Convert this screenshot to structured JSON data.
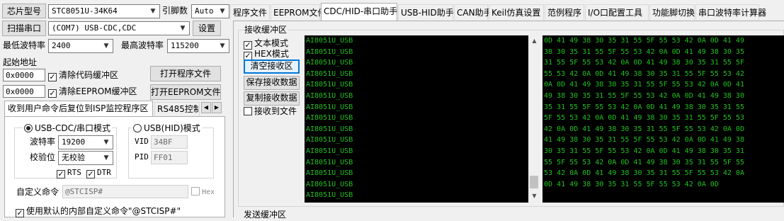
{
  "left": {
    "chip_label": "芯片型号",
    "chip_value": "STC8051U-34K64",
    "pin_label": "引脚数",
    "pin_value": "Auto",
    "scan_button": "扫描串口",
    "port_value": "(COM7) USB-CDC,CDC",
    "settings_button": "设置",
    "min_baud_label": "最低波特率",
    "min_baud_value": "2400",
    "max_baud_label": "最高波特率",
    "max_baud_value": "115200",
    "start_addr_label": "起始地址",
    "addr1": "0x0000",
    "clear_code_label": "清除代码缓冲区",
    "open_program_button": "打开程序文件",
    "addr2": "0x0000",
    "clear_eeprom_label": "清除EEPROM缓冲区",
    "open_eeprom_button": "打开EEPROM文件",
    "sub_tab_1": "收到用户命令后复位到ISP监控程序区",
    "sub_tab_2": "RS485控制",
    "usb_cdc_mode": "USB-CDC/串口模式",
    "usb_hid_mode": "USB(HID)模式",
    "baud_label": "波特率",
    "baud_value": "19200",
    "parity_label": "校验位",
    "parity_value": "无校验",
    "vid_label": "VID",
    "vid_value": "34BF",
    "pid_label": "PID",
    "pid_value": "FF01",
    "rts_label": "RTS",
    "dtr_label": "DTR",
    "custom_cmd_label": "自定义命令",
    "custom_cmd_value": "@STCISP#",
    "hex_label": "Hex",
    "use_default_label": "使用默认的内部自定义命令\"@STCISP#\""
  },
  "tabs": [
    "程序文件",
    "EEPROM文件",
    "CDC/HID-串口助手",
    "USB-HID助手",
    "CAN助手",
    "Keil仿真设置",
    "范例程序",
    "I/O口配置工具",
    "功能脚切换",
    "串口波特率计算器"
  ],
  "active_tab": 2,
  "serial": {
    "receive_buffer_label": "接收缓冲区",
    "text_mode_label": "文本模式",
    "hex_mode_label": "HEX模式",
    "clear_receive_button": "清空接收区",
    "save_receive_button": "保存接收数据",
    "copy_receive_button": "复制接收数据",
    "receive_to_file_label": "接收到文件",
    "send_buffer_label": "发送缓冲区",
    "text_lines": [
      "AI8051U_USB",
      "AI8051U_USB",
      "AI8051U_USB",
      "AI8051U_USB",
      "AI8051U_USB",
      "AI8051U_USB",
      "AI8051U_USB",
      "AI8051U_USB",
      "AI8051U_USB",
      "AI8051U_USB",
      "AI8051U_USB",
      "AI8051U_USB",
      "AI8051U_USB",
      "AI8051U_USB",
      "AI8051U_USB"
    ],
    "hex_lines": [
      "0D 41 49 38 30 35 31 55 5F 55 53 42 0A 0D 41 49",
      "38 30 35 31 55 5F 55 53 42 0A 0D 41 49 38 30 35",
      "31 55 5F 55 53 42 0A 0D 41 49 38 30 35 31 55 5F",
      "55 53 42 0A 0D 41 49 38 30 35 31 55 5F 55 53 42",
      "0A 0D 41 49 38 30 35 31 55 5F 55 53 42 0A 0D 41",
      "49 38 30 35 31 55 5F 55 53 42 0A 0D 41 49 38 30",
      "35 31 55 5F 55 53 42 0A 0D 41 49 38 30 35 31 55",
      "5F 55 53 42 0A 0D 41 49 38 30 35 31 55 5F 55 53",
      "42 0A 0D 41 49 38 30 35 31 55 5F 55 53 42 0A 0D",
      "41 49 38 30 35 31 55 5F 55 53 42 0A 0D 41 49 38",
      "30 35 31 55 5F 55 53 42 0A 0D 41 49 38 30 35 31",
      "55 5F 55 53 42 0A 0D 41 49 38 30 35 31 55 5F 55",
      "53 42 0A 0D 41 49 38 30 35 31 55 5F 55 53 42 0A",
      "0D 41 49 38 30 35 31 55 5F 55 53 42 0A 0D"
    ]
  },
  "colors": {
    "terminal_bg": "#000000",
    "terminal_text": "#1fc01f",
    "focus_blue": "#0078d7"
  }
}
